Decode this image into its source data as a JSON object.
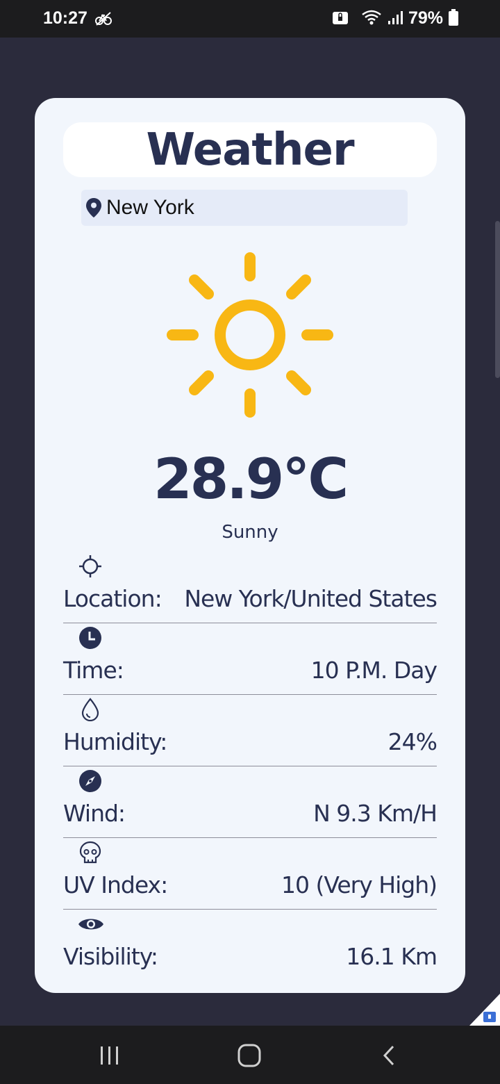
{
  "status_bar": {
    "time": "10:27",
    "battery": "79%",
    "icons": [
      "cycle-icon",
      "notification-lock-icon",
      "wifi-icon",
      "signal-icon",
      "battery-icon"
    ]
  },
  "app": {
    "title": "Weather",
    "search": {
      "value": "New York"
    },
    "current": {
      "temperature": "28.9°C",
      "condition": "Sunny",
      "icon": "sun-icon",
      "icon_color": "#f8b714"
    },
    "details": [
      {
        "icon": "crosshair-icon",
        "label": "Location:",
        "value": "New York/United States"
      },
      {
        "icon": "clock-icon",
        "label": "Time:",
        "value": "10 P.M. Day"
      },
      {
        "icon": "droplet-icon",
        "label": "Humidity:",
        "value": "24%"
      },
      {
        "icon": "compass-icon",
        "label": "Wind:",
        "value": "N 9.3 Km/H"
      },
      {
        "icon": "skull-icon",
        "label": "UV Index:",
        "value": "10 (Very High)"
      },
      {
        "icon": "eye-icon",
        "label": "Visibility:",
        "value": "16.1 Km"
      }
    ]
  },
  "nav_bar": {
    "buttons": [
      "recents-button",
      "home-button",
      "back-button"
    ]
  },
  "colors": {
    "background": "#2b2b3c",
    "card": "#f2f6fc",
    "text_primary": "#283052",
    "accent_sun": "#f8b714"
  }
}
